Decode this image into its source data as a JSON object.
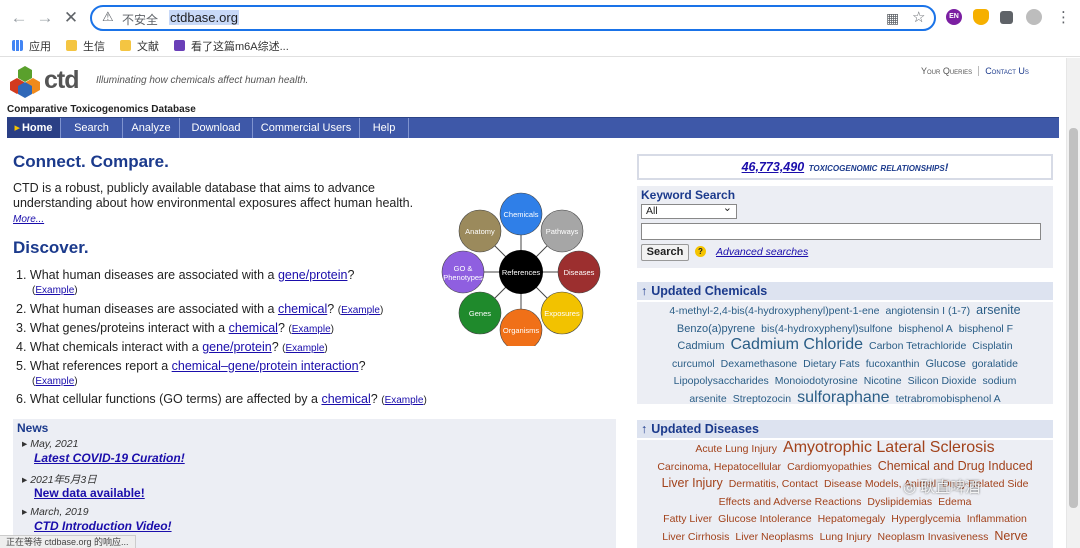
{
  "browser": {
    "security_label": "不安全",
    "url": "ctdbase.org",
    "ext_en_label": "EN",
    "bookmarks": [
      "应用",
      "生信",
      "文献",
      "看了这篇m6A综述..."
    ]
  },
  "header": {
    "logo": "ctd",
    "tagline": "Illuminating how chemicals affect human health.",
    "your_queries": "Your Queries",
    "contact_us": "Contact Us",
    "site_name": "Comparative Toxicogenomics Database"
  },
  "nav": [
    "Home",
    "Search",
    "Analyze",
    "Download",
    "Commercial Users",
    "Help"
  ],
  "main": {
    "connect_title": "Connect. Compare.",
    "intro": "CTD is a robust, publicly available database that aims to advance understanding about how environmental exposures affect human health.",
    "more": "More...",
    "discover_title": "Discover.",
    "questions": [
      {
        "pre": "1. What human diseases are associated with a ",
        "link": "gene/protein",
        "post": "?"
      },
      {
        "pre": "2. What human diseases are associated with a ",
        "link": "chemical",
        "post": "?"
      },
      {
        "pre": "3. What genes/proteins interact with a ",
        "link": "chemical",
        "post": "?"
      },
      {
        "pre": "4. What chemicals interact with a ",
        "link": "gene/protein",
        "post": "?"
      },
      {
        "pre": "5. What references report a ",
        "link": "chemical–gene/protein interaction",
        "post": "?"
      },
      {
        "pre": "6. What cellular functions (GO terms) are affected by a ",
        "link": "chemical",
        "post": "?"
      }
    ],
    "example_label": "Example",
    "wheel": {
      "center": "References",
      "nodes": [
        {
          "label": "Chemicals",
          "color": "#2f7fe8"
        },
        {
          "label": "Pathways",
          "color": "#a6a6a6"
        },
        {
          "label": "Diseases",
          "color": "#9c2f2f"
        },
        {
          "label": "Exposures",
          "color": "#f2c200"
        },
        {
          "label": "Organisms",
          "color": "#f07018"
        },
        {
          "label": "Genes",
          "color": "#1f8a2c"
        },
        {
          "label": "GO &",
          "label2": "Phenotypes",
          "color": "#8f5fe0"
        },
        {
          "label": "Anatomy",
          "color": "#9b8a5c"
        }
      ]
    }
  },
  "news": {
    "title": "News",
    "items": [
      {
        "date": "May, 2021",
        "link": "Latest COVID-19 Curation!"
      },
      {
        "date": "2021年5月3日",
        "link": "New data available!"
      },
      {
        "date": "March, 2019",
        "link": "CTD Introduction Video!"
      }
    ]
  },
  "right": {
    "relationships_count": "46,773,490",
    "relationships_label": "toxicogenomic relationships!",
    "keyword_title": "Keyword Search",
    "keyword_select": "All",
    "search_button": "Search",
    "help_glyph": "?",
    "advanced": "Advanced searches",
    "updated_chemicals_title": "Updated Chemicals",
    "chemical_rows": [
      [
        {
          "t": "4-methyl-2,4-bis(4-hydroxyphenyl)pent-1-ene",
          "s": 10.5
        },
        {
          "t": "angiotensin I (1-7)",
          "s": 10.5
        },
        {
          "t": "arsenite",
          "s": 12.5
        }
      ],
      [
        {
          "t": "Benzo(a)pyrene",
          "s": 11
        },
        {
          "t": "bis(4-hydroxyphenyl)sulfone",
          "s": 10.5
        },
        {
          "t": "bisphenol A",
          "s": 10.5
        },
        {
          "t": "bisphenol F",
          "s": 10.5
        }
      ],
      [
        {
          "t": "Cadmium",
          "s": 11
        },
        {
          "t": "Cadmium Chloride",
          "s": 16
        },
        {
          "t": "Carbon Tetrachloride",
          "s": 10.5
        },
        {
          "t": "Cisplatin",
          "s": 10.5
        }
      ],
      [
        {
          "t": "curcumol",
          "s": 10.5
        },
        {
          "t": "Dexamethasone",
          "s": 10.5
        },
        {
          "t": "Dietary Fats",
          "s": 10.5
        },
        {
          "t": "fucoxanthin",
          "s": 10.5
        },
        {
          "t": "Glucose",
          "s": 11
        },
        {
          "t": "goralatide",
          "s": 10.5
        }
      ],
      [
        {
          "t": "Lipopolysaccharides",
          "s": 10.5
        },
        {
          "t": "Monoiodotyrosine",
          "s": 10.5
        },
        {
          "t": "Nicotine",
          "s": 10.5
        },
        {
          "t": "Silicon Dioxide",
          "s": 10.5
        },
        {
          "t": "sodium",
          "s": 10.5
        }
      ],
      [
        {
          "t": "arsenite",
          "s": 10.5
        },
        {
          "t": "Streptozocin",
          "s": 10.5
        },
        {
          "t": "sulforaphane",
          "s": 16
        },
        {
          "t": "tetrabromobisphenol A",
          "s": 10.5
        }
      ]
    ],
    "updated_diseases_title": "Updated Diseases",
    "disease_rows": [
      [
        {
          "t": "Acute Lung Injury",
          "s": 10.5
        },
        {
          "t": "Amyotrophic Lateral Sclerosis",
          "s": 16
        }
      ],
      [
        {
          "t": "Carcinoma, Hepatocellular",
          "s": 10.5
        },
        {
          "t": "Cardiomyopathies",
          "s": 10.5
        },
        {
          "t": "Chemical and Drug Induced",
          "s": 12.5
        }
      ],
      [
        {
          "t": "Liver Injury",
          "s": 12.5
        },
        {
          "t": "Dermatitis, Contact",
          "s": 10.5
        },
        {
          "t": "Disease Models, Animal",
          "s": 10.5
        },
        {
          "t": "Drug-Related Side",
          "s": 10.5
        }
      ],
      [
        {
          "t": "Effects and Adverse Reactions",
          "s": 10.5
        },
        {
          "t": "Dyslipidemias",
          "s": 10.5
        },
        {
          "t": "Edema",
          "s": 10.5
        }
      ],
      [
        {
          "t": "Fatty Liver",
          "s": 10.5
        },
        {
          "t": "Glucose Intolerance",
          "s": 10.5
        },
        {
          "t": "Hepatomegaly",
          "s": 10.5
        },
        {
          "t": "Hyperglycemia",
          "s": 10.5
        },
        {
          "t": "Inflammation",
          "s": 10.5
        }
      ],
      [
        {
          "t": "Liver Cirrhosis",
          "s": 10.5
        },
        {
          "t": "Liver Neoplasms",
          "s": 10.5
        },
        {
          "t": "Lung Injury",
          "s": 10.5
        },
        {
          "t": "Neoplasm Invasiveness",
          "s": 10.5
        },
        {
          "t": "Nerve",
          "s": 12.5
        }
      ]
    ]
  },
  "watermark": "耿直啤酒",
  "status_text": "正在等待 ctdbase.org 的响应..."
}
